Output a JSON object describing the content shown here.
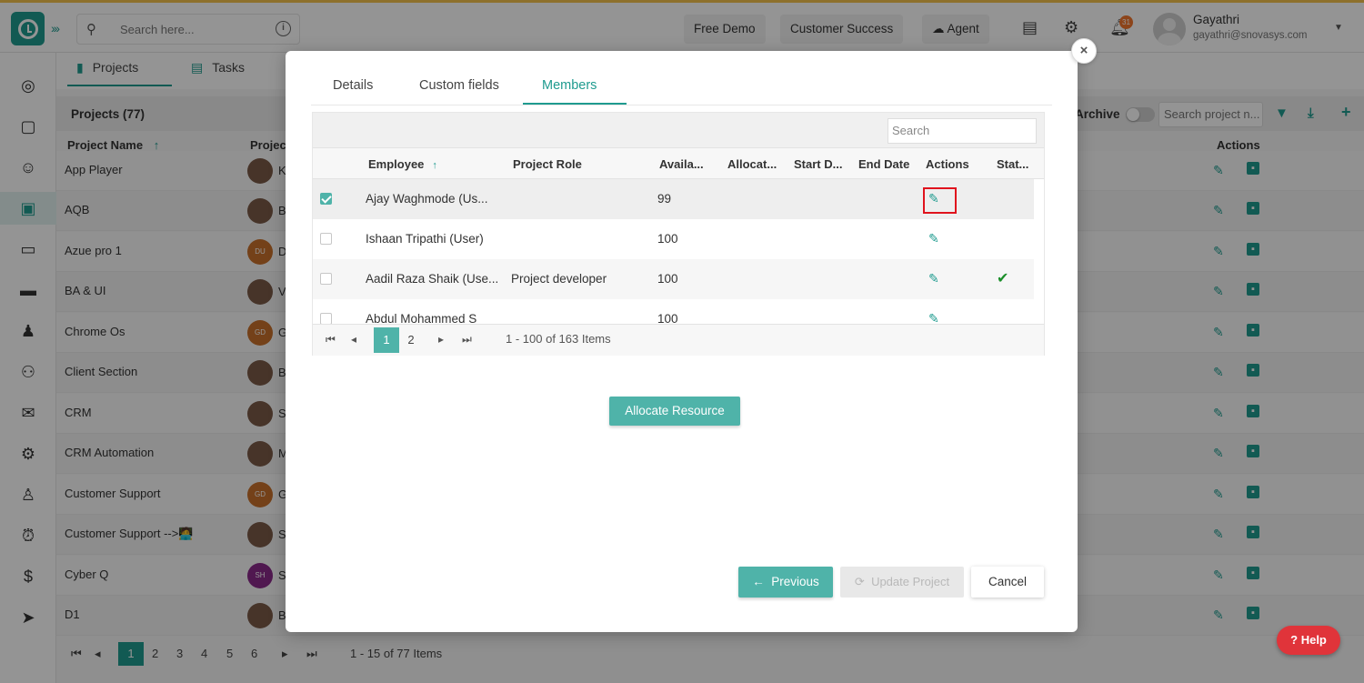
{
  "topbar": {
    "search_placeholder": "Search here...",
    "buttons": [
      "Free Demo",
      "Customer Success",
      "Agent"
    ],
    "notification_count": "31",
    "user_name": "Gayathri",
    "user_email": "gayathri@snovasys.com",
    "accent": "#1f9b8f"
  },
  "app_tabs": [
    "Projects",
    "Tasks"
  ],
  "projects": {
    "title": "Projects (77)",
    "archive_label": "Archive",
    "search_placeholder": "Search project n...",
    "columns": [
      "Project Name",
      "Projec",
      "Actions"
    ],
    "rows": [
      {
        "name": "App Player",
        "member": "K"
      },
      {
        "name": "AQB",
        "member": "B"
      },
      {
        "name": "Azue pro 1",
        "member": "D",
        "initials": "DU"
      },
      {
        "name": "BA & UI",
        "member": "V"
      },
      {
        "name": "Chrome Os",
        "member": "G",
        "initials": "GD"
      },
      {
        "name": "Client Section",
        "member": "B"
      },
      {
        "name": "CRM",
        "member": "S"
      },
      {
        "name": "CRM Automation",
        "member": "M"
      },
      {
        "name": "Customer Support",
        "member": "G",
        "initials": "GD"
      },
      {
        "name": "Customer Support -->🧑‍💻",
        "member": "S"
      },
      {
        "name": "Cyber Q",
        "member": "S",
        "initials": "SH"
      },
      {
        "name": "D1",
        "member": "B"
      }
    ],
    "pagination": {
      "pages": [
        "1",
        "2",
        "3",
        "4",
        "5",
        "6"
      ],
      "active": "1",
      "summary": "1 - 15 of 77 Items"
    }
  },
  "modal": {
    "tabs": [
      "Details",
      "Custom fields",
      "Members"
    ],
    "active_tab": "Members",
    "grid_search_placeholder": "Search",
    "columns": [
      "Employee",
      "Project Role",
      "Availa...",
      "Allocat...",
      "Start D...",
      "End Date",
      "Actions",
      "Stat..."
    ],
    "rows": [
      {
        "employee": "Ajay Waghmode (Us...",
        "role": "",
        "availability": "99",
        "checked": true,
        "status": ""
      },
      {
        "employee": "Ishaan Tripathi (User)",
        "role": "",
        "availability": "100",
        "checked": false,
        "status": ""
      },
      {
        "employee": "Aadil Raza Shaik (Use...",
        "role": "Project developer",
        "availability": "100",
        "checked": false,
        "status": "✔"
      },
      {
        "employee": "Abdul Mohammed S",
        "role": "",
        "availability": "100",
        "checked": false,
        "status": ""
      }
    ],
    "pagination": {
      "pages": [
        "1",
        "2"
      ],
      "active": "1",
      "summary": "1 - 100 of 163 Items"
    },
    "allocate_label": "Allocate Resource",
    "previous_label": "Previous",
    "update_label": "Update Project",
    "cancel_label": "Cancel",
    "close_glyph": "×"
  },
  "help_label": "Help"
}
